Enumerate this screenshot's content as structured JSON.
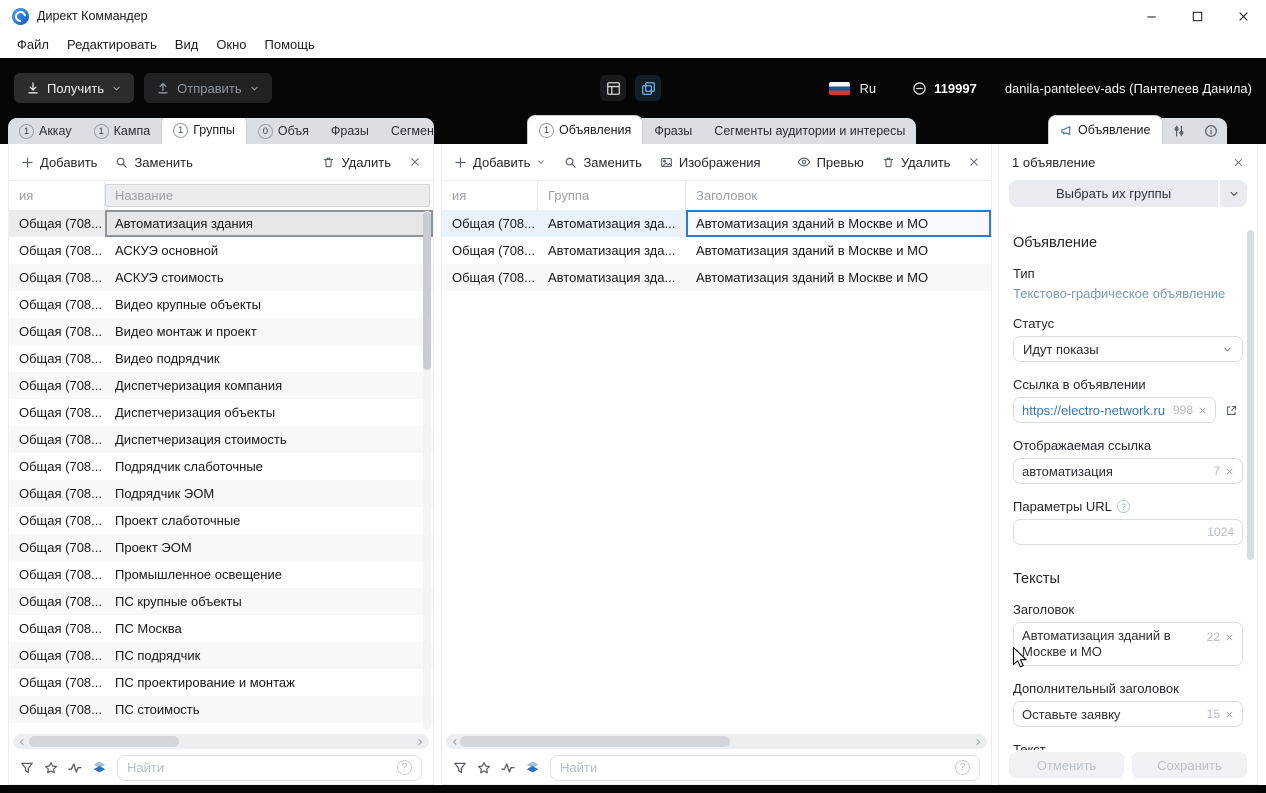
{
  "window": {
    "title": "Директ Коммандер",
    "menu": [
      "Файл",
      "Редактировать",
      "Вид",
      "Окно",
      "Помощь"
    ]
  },
  "icons": {
    "help": "?"
  },
  "topbar": {
    "get": "Получить",
    "send": "Отправить",
    "lang": "Ru",
    "units": "119997",
    "account": "danila-panteleev-ads (Пантелеев Данила)"
  },
  "groups_panel": {
    "tabs": [
      {
        "count": "1",
        "label": "Аккау"
      },
      {
        "count": "1",
        "label": "Кампа"
      },
      {
        "count": "1",
        "label": "Группы",
        "_class": "active"
      },
      {
        "count": "0",
        "label": "Объя"
      },
      {
        "label": "Фразы"
      },
      {
        "label": "Сегменты"
      }
    ],
    "toolbar": {
      "add": "Добавить",
      "replace": "Заменить",
      "delete": "Удалить"
    },
    "columns": {
      "campaign": "ия",
      "name": "Название"
    },
    "rows": [
      {
        "campaign": "Общая (708...",
        "name": "Автоматизация здания",
        "_class": "selected"
      },
      {
        "campaign": "Общая (708...",
        "name": "АСКУЭ основной"
      },
      {
        "campaign": "Общая (708...",
        "name": "АСКУЭ стоимость"
      },
      {
        "campaign": "Общая (708...",
        "name": "Видео крупные объекты"
      },
      {
        "campaign": "Общая (708...",
        "name": "Видео монтаж и проект"
      },
      {
        "campaign": "Общая (708...",
        "name": "Видео подрядчик"
      },
      {
        "campaign": "Общая (708...",
        "name": "Диспетчеризация компания"
      },
      {
        "campaign": "Общая (708...",
        "name": "Диспетчеризация объекты"
      },
      {
        "campaign": "Общая (708...",
        "name": "Диспетчеризация стоимость"
      },
      {
        "campaign": "Общая (708...",
        "name": "Подрядчик слаботочные"
      },
      {
        "campaign": "Общая (708...",
        "name": "Подрядчик ЭОМ"
      },
      {
        "campaign": "Общая (708...",
        "name": "Проект слаботочные"
      },
      {
        "campaign": "Общая (708...",
        "name": "Проект ЭОМ"
      },
      {
        "campaign": "Общая (708...",
        "name": "Промышленное освещение"
      },
      {
        "campaign": "Общая (708...",
        "name": "ПС крупные объекты"
      },
      {
        "campaign": "Общая (708...",
        "name": "ПС Москва"
      },
      {
        "campaign": "Общая (708...",
        "name": "ПС подрядчик"
      },
      {
        "campaign": "Общая (708...",
        "name": "ПС проектирование и монтаж"
      },
      {
        "campaign": "Общая (708...",
        "name": "ПС стоимость"
      }
    ],
    "search_placeholder": "Найти"
  },
  "ads_panel": {
    "tabs": [
      {
        "count": "1",
        "label": "Объявления",
        "_class": "active"
      },
      {
        "label": "Фразы"
      },
      {
        "label": "Сегменты аудитории и интересы"
      }
    ],
    "toolbar": {
      "add": "Добавить",
      "replace": "Заменить",
      "images": "Изображения",
      "preview": "Превью",
      "delete": "Удалить"
    },
    "columns": {
      "campaign": "ия",
      "group": "Группа",
      "title": "Заголовок"
    },
    "rows": [
      {
        "campaign": "Общая (708...",
        "group": "Автоматизация зда...",
        "title": "Автоматизация зданий в Москве и МО",
        "_class": "selected"
      },
      {
        "campaign": "Общая (708...",
        "group": "Автоматизация зда...",
        "title": "Автоматизация зданий в Москве и МО"
      },
      {
        "campaign": "Общая (708...",
        "group": "Автоматизация зда...",
        "title": "Автоматизация зданий в Москве и МО"
      }
    ],
    "search_placeholder": "Найти"
  },
  "inspector": {
    "tab": "Объявление",
    "header": "1 объявление",
    "select_groups": "Выбрать их группы",
    "section_ad": "Объявление",
    "type_label": "Тип",
    "type_value": "Текстово-графическое объявление",
    "status_label": "Статус",
    "status_value": "Идут показы",
    "link_label": "Ссылка в объявлении",
    "link_value": "https://electro-network.ru",
    "link_counter": "998",
    "display_link_label": "Отображаемая ссылка",
    "display_link_value": "автоматизация",
    "display_link_counter": "7",
    "url_params_label": "Параметры URL",
    "url_params_counter": "1024",
    "section_texts": "Тексты",
    "title_label": "Заголовок",
    "title_value": "Автоматизация зданий в Москве и МО",
    "title_counter": "22",
    "extra_title_label": "Дополнительный заголовок",
    "extra_title_value": "Оставьте заявку",
    "extra_title_counter": "15",
    "text_label": "Текст",
    "cancel": "Отменить",
    "save": "Сохранить"
  }
}
